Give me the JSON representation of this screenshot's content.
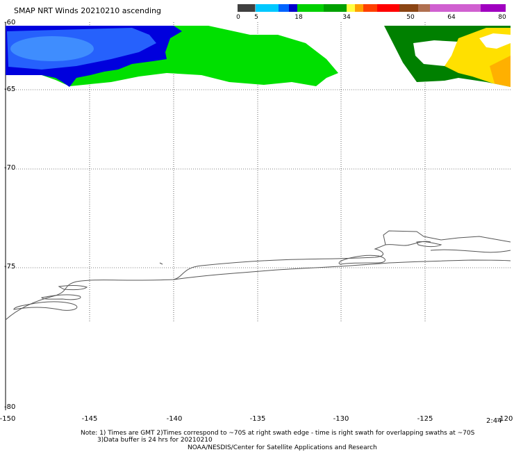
{
  "title": "SMAP NRT Winds 20210210 ascending",
  "colorbar": {
    "labels": [
      "0",
      "5",
      "18",
      "34",
      "50",
      "64",
      "80"
    ],
    "colors": [
      "#404040",
      "#9a9a9a",
      "#00c8ff",
      "#0064ff",
      "#0000cc",
      "#00d000",
      "#00a000",
      "#ffff40",
      "#ffa000",
      "#ff4000",
      "#ff0000",
      "#8b4513",
      "#b07050",
      "#d060d0",
      "#a000c0"
    ]
  },
  "map": {
    "lat_labels": [
      "-60",
      "-65",
      "-70",
      "-75",
      "-80"
    ],
    "lon_labels": [
      "-150",
      "-145",
      "-140",
      "-135",
      "-130",
      "-125",
      "-120"
    ],
    "legend_colors": {
      "strong_low": "#0000dd",
      "moderate": "#00e000",
      "high": "#008000",
      "very_high": "#ffe000"
    }
  },
  "time_stamp": "2:44",
  "notes": {
    "line1": "Note: 1) Times are GMT 2)Times correspond to ~70S at right swath edge - time is right swath for overlapping swaths at ~70S",
    "line2": "3)Data buffer is 24 hrs for 20210210",
    "line3": "NOAA/NESDIS/Center for Satellite Applications and Research"
  }
}
